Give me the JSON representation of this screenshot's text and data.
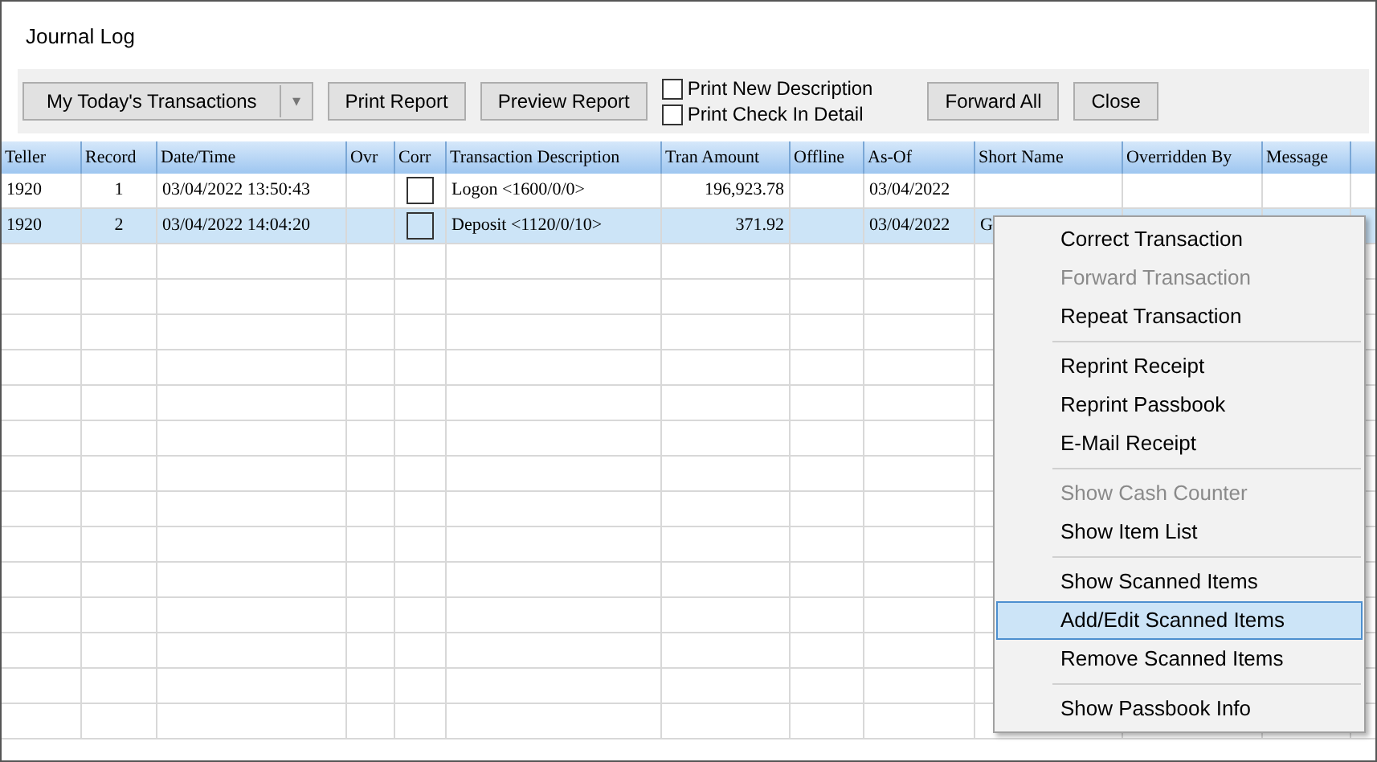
{
  "window": {
    "title": "Journal Log"
  },
  "toolbar": {
    "filter": {
      "value": "My Today's Transactions",
      "arrow": "▾"
    },
    "buttons_left": [
      "Print Report",
      "Preview Report"
    ],
    "checkboxes": [
      {
        "label": "Print New Description",
        "checked": false
      },
      {
        "label": "Print Check In Detail",
        "checked": false
      }
    ],
    "buttons_right": [
      "Forward All",
      "Close"
    ]
  },
  "table": {
    "columns": [
      "Teller",
      "Record",
      "Date/Time",
      "Ovr",
      "Corr",
      "Transaction Description",
      "Tran Amount",
      "Offline",
      "As-Of",
      "Short Name",
      "Overridden By",
      "Message"
    ],
    "rows": [
      {
        "selected": false,
        "corr": false,
        "cells": [
          "1920",
          "1",
          "03/04/2022 13:50:43",
          "",
          "",
          "Logon <1600/0/0>",
          "196,923.78",
          "",
          "03/04/2022",
          "",
          "",
          ""
        ]
      },
      {
        "selected": true,
        "corr": false,
        "cells": [
          "1920",
          "2",
          "03/04/2022 14:04:20",
          "",
          "",
          "Deposit <1120/0/10>",
          "371.92",
          "",
          "03/04/2022",
          "G",
          "",
          ""
        ]
      }
    ]
  },
  "context_menu": {
    "items": [
      {
        "kind": "item",
        "label": "Correct Transaction",
        "disabled": false,
        "selected": false
      },
      {
        "kind": "item",
        "label": "Forward Transaction",
        "disabled": true,
        "selected": false
      },
      {
        "kind": "item",
        "label": "Repeat Transaction",
        "disabled": false,
        "selected": false
      },
      {
        "kind": "separator"
      },
      {
        "kind": "item",
        "label": "Reprint Receipt",
        "disabled": false,
        "selected": false
      },
      {
        "kind": "item",
        "label": "Reprint Passbook",
        "disabled": false,
        "selected": false
      },
      {
        "kind": "item",
        "label": "E-Mail Receipt",
        "disabled": false,
        "selected": false
      },
      {
        "kind": "separator"
      },
      {
        "kind": "item",
        "label": "Show Cash Counter",
        "disabled": true,
        "selected": false
      },
      {
        "kind": "item",
        "label": "Show Item List",
        "disabled": false,
        "selected": false
      },
      {
        "kind": "separator"
      },
      {
        "kind": "item",
        "label": "Show Scanned Items",
        "disabled": false,
        "selected": false
      },
      {
        "kind": "item",
        "label": "Add/Edit Scanned Items",
        "disabled": false,
        "selected": true
      },
      {
        "kind": "item",
        "label": "Remove Scanned Items",
        "disabled": false,
        "selected": false
      },
      {
        "kind": "separator"
      },
      {
        "kind": "item",
        "label": "Show Passbook Info",
        "disabled": false,
        "selected": false
      }
    ]
  }
}
